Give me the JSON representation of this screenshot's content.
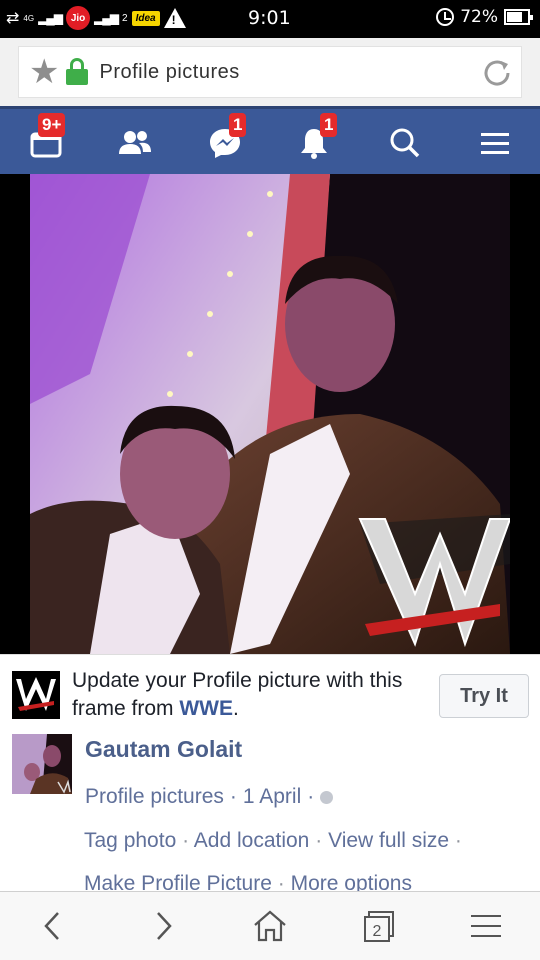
{
  "status_bar": {
    "network_label": "4G",
    "carrier1": "Jio",
    "sim2_label": "2",
    "carrier2": "Idea",
    "warning_glyph": "!",
    "time": "9:01",
    "battery": "72%"
  },
  "address_bar": {
    "title": "Profile pictures",
    "icons": [
      "star-icon",
      "lock-icon",
      "reload-icon"
    ]
  },
  "fb_nav": {
    "items": [
      {
        "name": "feed",
        "badge": "9+"
      },
      {
        "name": "friend-requests",
        "badge": ""
      },
      {
        "name": "messages",
        "badge": "1"
      },
      {
        "name": "notifications",
        "badge": "1"
      },
      {
        "name": "search",
        "badge": ""
      },
      {
        "name": "menu",
        "badge": ""
      }
    ],
    "color": "#3b5998"
  },
  "promo": {
    "text": "Update your Profile picture with this frame from ",
    "brand": "WWE",
    "suffix": ".",
    "button": "Try It"
  },
  "post": {
    "author": "Gautam Golait",
    "album": "Profile pictures",
    "sep": "·",
    "date": "1 April",
    "actions_line1": [
      "Tag photo",
      "Add location",
      "View full size"
    ],
    "actions_line2": [
      "Make Profile Picture",
      "More options"
    ]
  },
  "bottom_bar": {
    "tab_count": "2",
    "icons": [
      "back-icon",
      "forward-icon",
      "home-icon",
      "tabs-icon",
      "menu-icon"
    ]
  }
}
